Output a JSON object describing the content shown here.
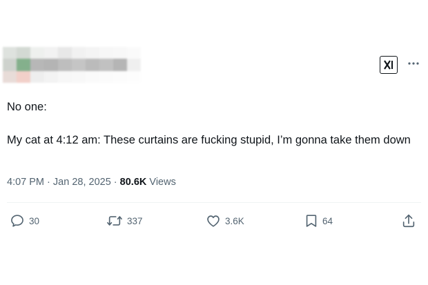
{
  "header": {
    "avatar_colors": [
      "#d9ddd9",
      "#ccd3cc",
      "#eceeec",
      "#f0f0f0",
      "#e4e4e4",
      "#efefef",
      "#f3f3f3",
      "#f6f6f6",
      "#f7f7f7",
      "#fafafa",
      "#c6cbc5",
      "#6fa379",
      "#ababab",
      "#a7a7a7",
      "#b3b3b3",
      "#bcbcbc",
      "#b0b0b0",
      "#b7b7b7",
      "#a9a9a9",
      "#ededed",
      "#e5d6d2",
      "#f0c8c0",
      "#ececec",
      "#f1f1f1",
      "#f6f6f6",
      "#f7f7f7",
      "#fafafa",
      "#fbfbfb",
      "#fcfcfc",
      "#fdfdfd"
    ],
    "logo_icon": "xai-logo-icon",
    "more_icon": "more-icon"
  },
  "tweet": {
    "text": "No one:\n\nMy cat at 4:12 am: These curtains are fucking stupid, I’m gonna take them down",
    "time": "4:07 PM",
    "separator": "·",
    "date": "Jan 28, 2025",
    "views_count": "80.6K",
    "views_label": "Views"
  },
  "actions": {
    "reply_count": "30",
    "retweet_count": "337",
    "like_count": "3.6K",
    "bookmark_count": "64"
  },
  "colors": {
    "text": "#0f1419",
    "secondary": "#536471",
    "divider": "#eff3f4"
  }
}
